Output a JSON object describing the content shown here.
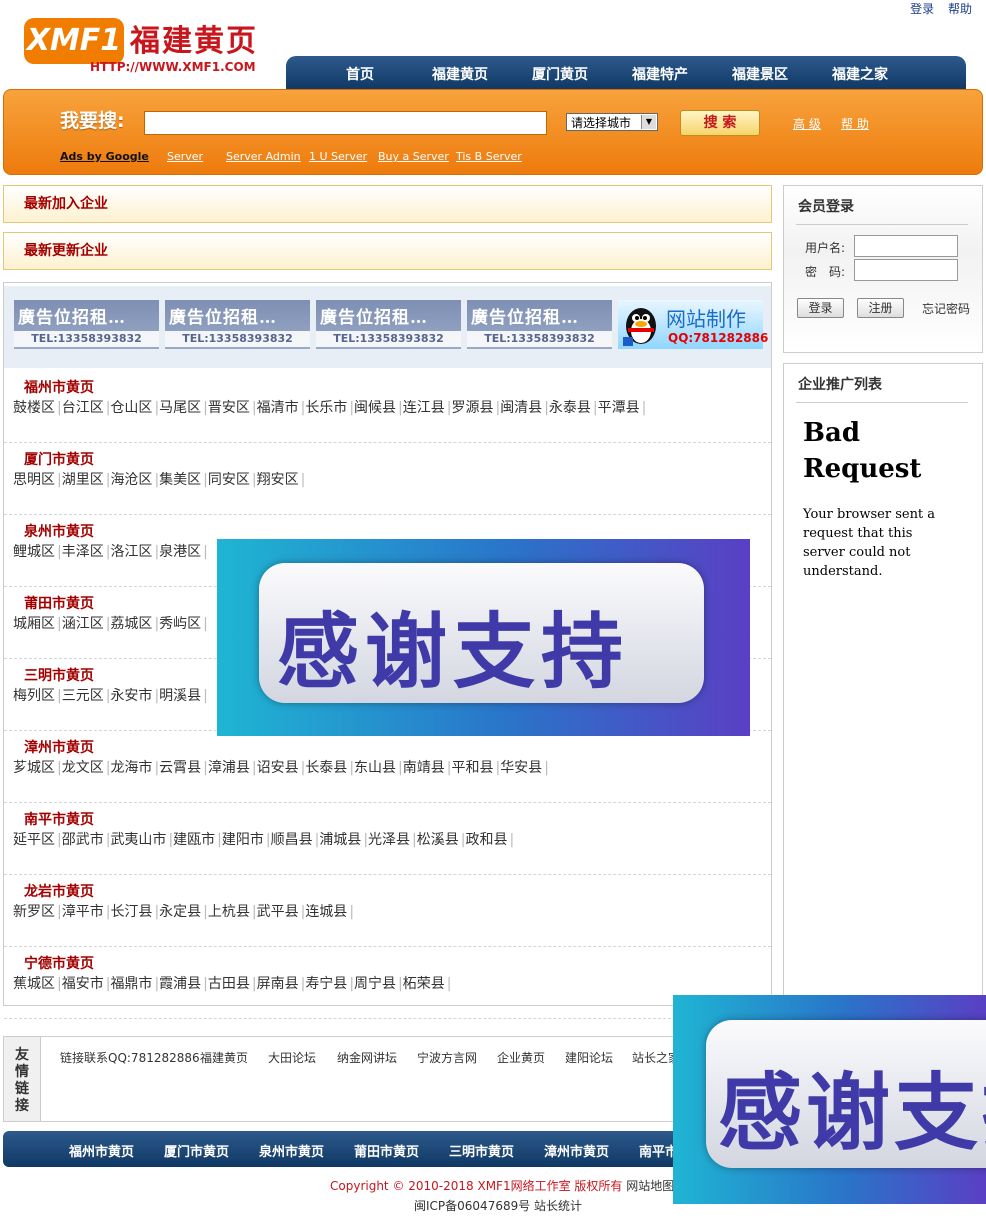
{
  "top_links": [
    "登录",
    "帮助"
  ],
  "logo": {
    "badge": "XMF1",
    "cn": "福建黄页",
    "url": "HTTP://WWW.XMF1.COM"
  },
  "nav": [
    "首页",
    "福建黄页",
    "厦门黄页",
    "福建特产",
    "福建景区",
    "福建之家"
  ],
  "search": {
    "label": "我要搜:",
    "city_select": "请选择城市",
    "button": "搜 索",
    "advanced": "高 级",
    "help": "帮 助",
    "ads": [
      "Ads by Google",
      "Server",
      "Server Admin",
      "1 U Server",
      "Buy a Server",
      "Tis B Server"
    ]
  },
  "panels": {
    "newest": "最新加入企业",
    "updated": "最新更新企业"
  },
  "ad_banner": {
    "text": "廣告位招租…",
    "tel": "TEL:13358393832",
    "qq_title": "网站制作",
    "qq_num": "QQ:781282886"
  },
  "cities": [
    {
      "name": "福州市黄页",
      "districts": [
        "鼓楼区",
        "台江区",
        "仓山区",
        "马尾区",
        "晋安区",
        "福清市",
        "长乐市",
        "闽候县",
        "连江县",
        "罗源县",
        "闽清县",
        "永泰县",
        "平潭县"
      ]
    },
    {
      "name": "厦门市黄页",
      "districts": [
        "思明区",
        "湖里区",
        "海沧区",
        "集美区",
        "同安区",
        "翔安区"
      ]
    },
    {
      "name": "泉州市黄页",
      "districts": [
        "鲤城区",
        "丰泽区",
        "洛江区",
        "泉港区"
      ]
    },
    {
      "name": "莆田市黄页",
      "districts": [
        "城厢区",
        "涵江区",
        "荔城区",
        "秀屿区"
      ]
    },
    {
      "name": "三明市黄页",
      "districts": [
        "梅列区",
        "三元区",
        "永安市",
        "明溪县"
      ]
    },
    {
      "name": "漳州市黄页",
      "districts": [
        "芗城区",
        "龙文区",
        "龙海市",
        "云霄县",
        "漳浦县",
        "诏安县",
        "长泰县",
        "东山县",
        "南靖县",
        "平和县",
        "华安县"
      ]
    },
    {
      "name": "南平市黄页",
      "districts": [
        "延平区",
        "邵武市",
        "武夷山市",
        "建瓯市",
        "建阳市",
        "顺昌县",
        "浦城县",
        "光泽县",
        "松溪县",
        "政和县"
      ]
    },
    {
      "name": "龙岩市黄页",
      "districts": [
        "新罗区",
        "漳平市",
        "长汀县",
        "永定县",
        "上杭县",
        "武平县",
        "连城县"
      ]
    },
    {
      "name": "宁德市黄页",
      "districts": [
        "蕉城区",
        "福安市",
        "福鼎市",
        "霞浦县",
        "古田县",
        "屏南县",
        "寿宁县",
        "周宁县",
        "柘荣县"
      ]
    }
  ],
  "overlay": {
    "thanks": "感谢支持",
    "thanks_cut": "感谢支持"
  },
  "login": {
    "title": "会员登录",
    "user_label": "用户名:",
    "pass_label": "密　码:",
    "login_btn": "登录",
    "register_btn": "注册",
    "forgot": "忘记密码"
  },
  "promo": {
    "title": "企业推广列表",
    "error_title": "Bad Request",
    "error_text": "Your browser sent a request that this server could not understand."
  },
  "friend_links": {
    "label": "友情链接",
    "items": [
      "链接联系QQ:781282886",
      "福建黄页",
      "大田论坛",
      "纳金网讲坛",
      "宁波方言网",
      "企业黄页",
      "建阳论坛",
      "站长之家"
    ]
  },
  "bottom_nav": [
    "福州市黄页",
    "厦门市黄页",
    "泉州市黄页",
    "莆田市黄页",
    "三明市黄页",
    "漳州市黄页",
    "南平市"
  ],
  "footer": {
    "copyright": "Copyright © 2010-2018 XMF1网络工作室 版权所有",
    "sitemap": "网站地图",
    "icp": "闽ICP备06047689号 站长统计"
  }
}
